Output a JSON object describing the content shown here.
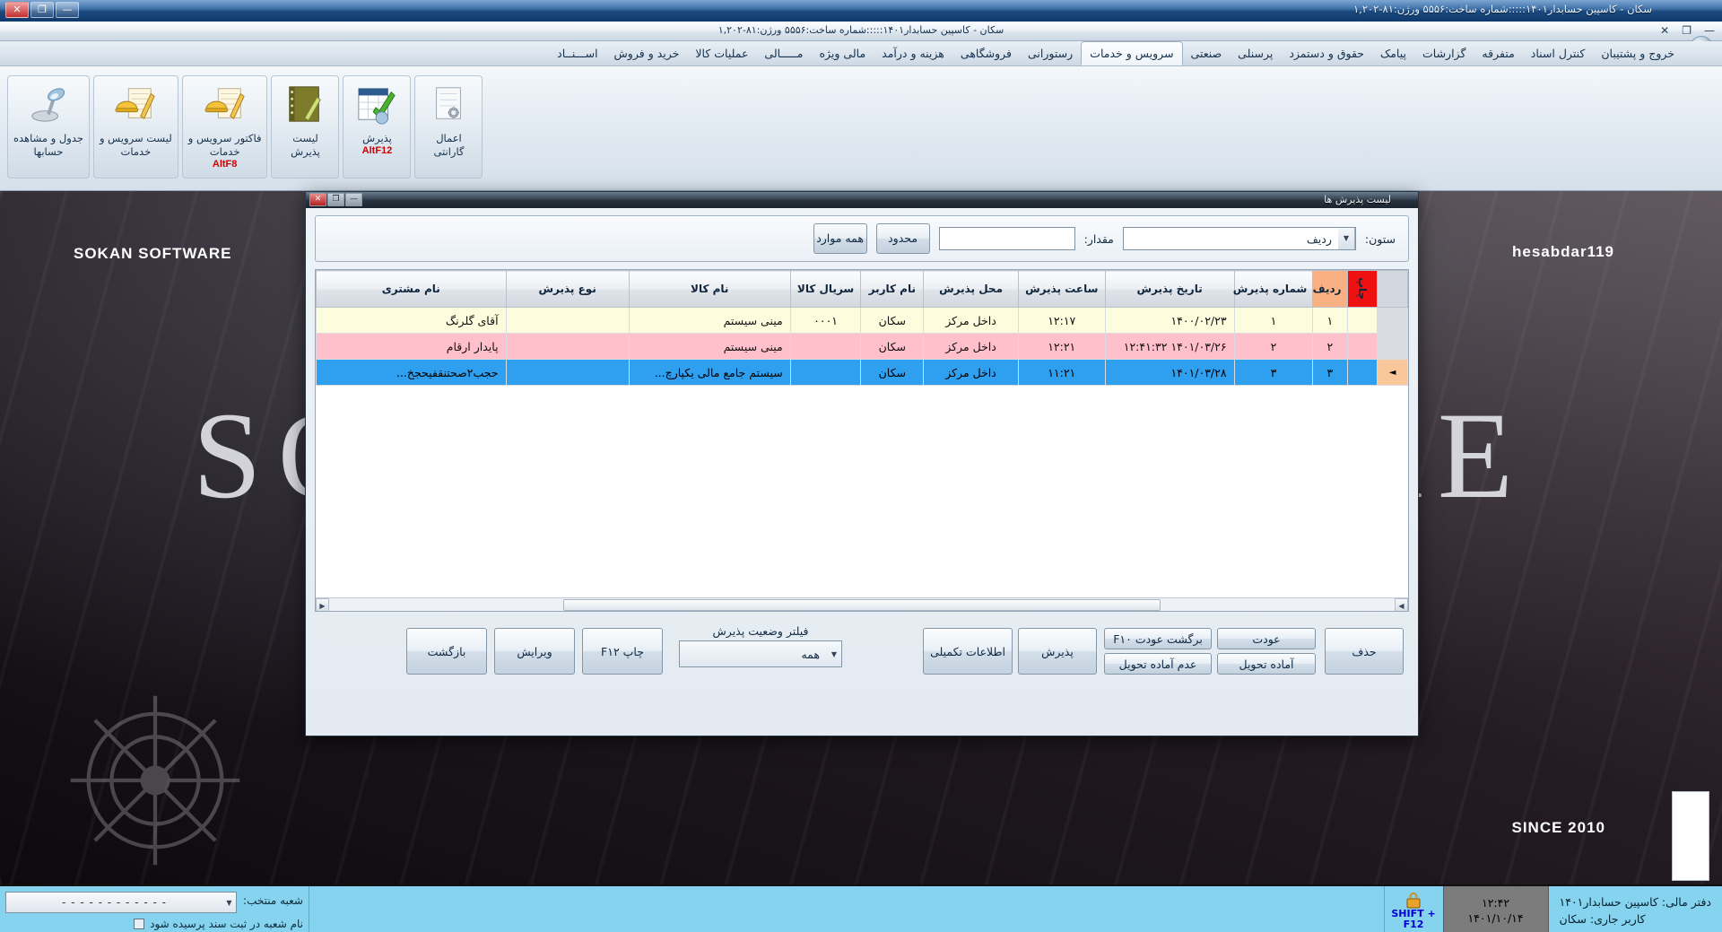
{
  "os_window": {
    "title": "سکان - کاسپین حسابدار۱۴۰۱:::::شماره ساخت:۵۵۵۶   ورژن:۸۱-۱,۲۰۲",
    "minimize": "—",
    "maximize": "❐",
    "close": "✕"
  },
  "mdi_window": {
    "title": "سکان - کاسپین حسابدار۱۴۰۱:::::شماره ساخت:۵۵۵۶  ورژن:۸۱-۱,۲۰۲",
    "close": "✕",
    "restore": "❐",
    "minimize": "—"
  },
  "menubar": {
    "items": [
      {
        "label": "خروج و پشتیبان",
        "active": false
      },
      {
        "label": "کنترل اسناد",
        "active": false
      },
      {
        "label": "متفرقه",
        "active": false
      },
      {
        "label": "گزارشات",
        "active": false
      },
      {
        "label": "پیامک",
        "active": false
      },
      {
        "label": "حقوق و دستمزد",
        "active": false
      },
      {
        "label": "پرسنلی",
        "active": false
      },
      {
        "label": "صنعتی",
        "active": false
      },
      {
        "label": "سرویس و خدمات",
        "active": true
      },
      {
        "label": "رستورانی",
        "active": false
      },
      {
        "label": "فروشگاهی",
        "active": false
      },
      {
        "label": "هزینه و درآمد",
        "active": false
      },
      {
        "label": "مالی ویژه",
        "active": false
      },
      {
        "label": "مـــــالی",
        "active": false
      },
      {
        "label": "عملیات کالا",
        "active": false
      },
      {
        "label": "خرید و فروش",
        "active": false
      },
      {
        "label": "اســـنــاد",
        "active": false
      }
    ]
  },
  "ribbon": {
    "buttons": [
      {
        "icon": "gear-icon",
        "label": "اعمال\nگارانتی",
        "shortcut": ""
      },
      {
        "icon": "calendar-check-icon",
        "label": "پذیرش",
        "shortcut": "AltF12"
      },
      {
        "icon": "notebook-icon",
        "label": "لیست\nپذیرش",
        "shortcut": ""
      },
      {
        "icon": "helmet-document-icon",
        "label": "فاکتور  سرویس و\nخدمات",
        "shortcut": "AltF8"
      },
      {
        "icon": "helmet-list-icon",
        "label": "لیست سرویس و\nخدمات",
        "shortcut": ""
      },
      {
        "icon": "lamp-icon",
        "label": "جدول و مشاهده\nحسابها",
        "shortcut": ""
      }
    ]
  },
  "wallpaper": {
    "brand_left": "SOKAN SOFTWARE",
    "brand_right": "hesabdar119",
    "since": "SINCE 2010",
    "big_text": "SOKAN SOFTWARE"
  },
  "dialog": {
    "title": "لیست پذیرش ها",
    "filter": {
      "column_label": "ستون:",
      "column_value": "ردیف",
      "value_label": "مقدار:",
      "value_text": "",
      "value_placeholder": "",
      "limited_button": "محدود",
      "all_button": "همه موارد"
    },
    "table": {
      "headers": [
        "چاپ",
        "ردیف",
        "شماره پذیرش",
        "تاریخ پذیرش",
        "ساعت پذیرش",
        "محل پذیرش",
        "نام کاربر",
        "سریال کالا",
        "نام کالا",
        "نوع پذیرش",
        "نام مشتری"
      ],
      "rows": [
        {
          "selector": "",
          "radif": "۱",
          "shomare": "۱",
          "tarikh": "۱۴۰۰/۰۲/۲۳",
          "saat": "۱۲:۱۷",
          "mahal": "داخل مرکز",
          "karbar": "سکان",
          "serial": "۰۰۰۱",
          "kala": "مینی سیستم",
          "noe": "",
          "moshtari": "آقای گلرنگ"
        },
        {
          "selector": "",
          "radif": "۲",
          "shomare": "۲",
          "tarikh": "۱۴۰۱/۰۳/۲۶ ۱۲:۴۱:۳۲",
          "saat": "۱۲:۲۱",
          "mahal": "داخل مرکز",
          "karbar": "سکان",
          "serial": "",
          "kala": "مینی سیستم",
          "noe": "",
          "moshtari": "پایدار ارقام"
        },
        {
          "selector": "◄",
          "radif": "۳",
          "shomare": "۳",
          "tarikh": "۱۴۰۱/۰۳/۲۸",
          "saat": "۱۱:۲۱",
          "mahal": "داخل مرکز",
          "karbar": "سکان",
          "serial": "",
          "kala": "سیستم جامع مالی یکپارچ...",
          "noe": "",
          "moshtari": "حجب۲صحتنقفیحجخ..."
        }
      ]
    },
    "buttons": {
      "delete": "حذف",
      "ready_deliver": "آماده تحویل",
      "not_ready_deliver": "عدم آماده تحویل",
      "return": "عودت",
      "return_back": "برگشت عودت F۱۰",
      "accept": "پذیرش",
      "extra_info": "اطلاعات تکمیلی",
      "print": "چاپ F۱۲",
      "edit": "ویرایش",
      "back": "بازگشت"
    },
    "status_filter": {
      "label": "فیلتر وضعیت پذیرش",
      "value": "همه"
    }
  },
  "statusbar": {
    "branch_label": "شعبه منتخب:",
    "branch_value": "- - - - - - - - - - - -",
    "ask_branch_text": "نام شعبه در ثبت سند پرسیده شود",
    "lock_text": "SHIFT +\nF12",
    "clock_time": "۱۲:۴۲",
    "clock_date": "۱۴۰۱/۱۰/۱۴",
    "ledger": "دفتر مالی: کاسپین حسابدار۱۴۰۱",
    "user": "کاربر جاری: سکان"
  },
  "colors": {
    "print_header": "#ee1111",
    "radif_header": "#f9b183",
    "row1": "#fdfcdd",
    "row2": "#ffc0cb",
    "row3_selected": "#2f9ff0",
    "statusbar": "#85d3ee"
  }
}
